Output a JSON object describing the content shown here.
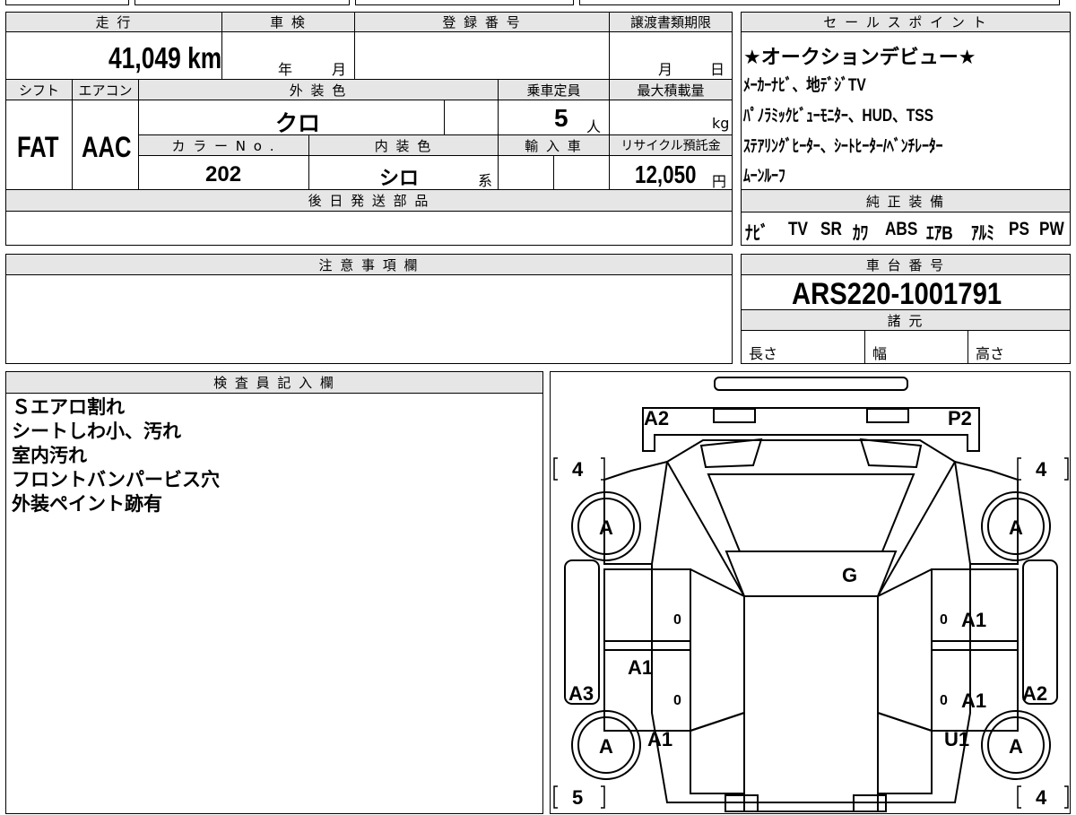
{
  "sheet": {
    "top_row": {
      "mileage_label": "走 行",
      "mileage_value": "41,049 km",
      "inspection_label": "車 検",
      "inspection_year_unit": "年",
      "inspection_month_unit": "月",
      "registration_label": "登 録 番 号",
      "transfer_label": "譲渡書類期限",
      "transfer_month_unit": "月",
      "transfer_day_unit": "日"
    },
    "second_row": {
      "shift_label": "シフト",
      "shift_value": "FAT",
      "aircon_label": "エアコン",
      "aircon_value": "AAC",
      "exterior_color_label": "外 装 色",
      "exterior_color_value": "クロ",
      "capacity_label": "乗車定員",
      "capacity_value": "5",
      "capacity_unit": "人",
      "max_load_label": "最大積載量",
      "max_load_unit": "kg",
      "color_no_label": "カ ラ ー N o .",
      "color_no_value": "202",
      "interior_color_label": "内 装 色",
      "interior_color_value": "シロ",
      "interior_color_suffix": "系",
      "import_label": "輸 入 車",
      "recycle_label": "リサイクル預託金",
      "recycle_value": "12,050",
      "recycle_unit": "円"
    },
    "later_parts_label": "後 日 発 送 部 品",
    "notes_label": "注 意 事 項 欄",
    "inspector_label": "検 査 員 記 入 欄",
    "inspector_notes": [
      "Ｓエアロ割れ",
      "シートしわ小、汚れ",
      "室内汚れ",
      "フロントバンパービス穴",
      "外装ペイント跡有"
    ]
  },
  "sales_points": {
    "label": "セ ー ル ス ポ イ ン ト",
    "lines": [
      "★オークションデビュー★",
      "ﾒｰｶｰﾅﾋﾞ、地ﾃﾞｼﾞTV",
      "ﾊﾟﾉﾗﾐｯｸﾋﾞｭｰﾓﾆﾀｰ、HUD、TSS",
      "ｽﾃｱﾘﾝｸﾞﾋｰﾀｰ、ｼｰﾄﾋｰﾀｰ/ﾍﾞﾝﾁﾚｰﾀｰ",
      "ﾑｰﾝﾙｰﾌ"
    ]
  },
  "genuine_equipment": {
    "label": "純 正 装 備",
    "items": [
      "ﾅﾋﾞ",
      "TV",
      "SR",
      "ｶﾜ",
      "ABS",
      "ｴｱB",
      "ｱﾙﾐ",
      "PS",
      "PW"
    ]
  },
  "chassis": {
    "label": "車 台 番 号",
    "value": "ARS220-1001791",
    "spec_label": "諸 元",
    "length_label": "長さ",
    "width_label": "幅",
    "height_label": "高さ"
  },
  "diagram": {
    "marks": {
      "a2_front_left": "A2",
      "p2_front_right": "P2",
      "tire_fl": "A",
      "tire_fr": "A",
      "tire_rl": "A",
      "tire_rr": "A",
      "hood_glass": "G",
      "door_fl": "0",
      "door_fr_zero": "0",
      "door_fr": "A1",
      "door_rl_a1": "A1",
      "door_rl_zero": "0",
      "door_rr_zero": "0",
      "door_rr": "A1",
      "sill_left": "A3",
      "sill_right": "A2",
      "rear_left": "A1",
      "rear_right": "U1"
    },
    "tread": {
      "fl": "4",
      "fr": "4",
      "rl": "5",
      "rr": "4"
    }
  }
}
